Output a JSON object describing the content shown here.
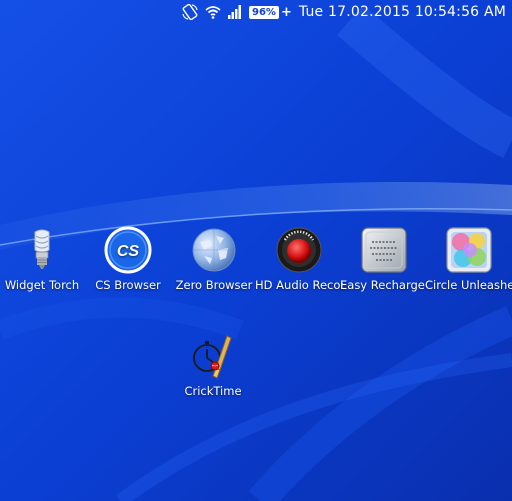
{
  "statusbar": {
    "battery_percent": "96%",
    "datetime": "Tue 17.02.2015 10:54:56 AM",
    "icons": [
      "rotate-icon",
      "wifi-icon",
      "signal-icon",
      "battery-icon"
    ]
  },
  "apps": [
    {
      "label": "Widget Torch",
      "icon": "bulb-icon"
    },
    {
      "label": "CS Browser",
      "icon": "cs-browser-icon",
      "badge": "CS"
    },
    {
      "label": "Zero Browser",
      "icon": "globe-icon"
    },
    {
      "label": "HD Audio Record",
      "icon": "record-icon"
    },
    {
      "label": "Easy Recharge BD",
      "icon": "recharge-icon"
    },
    {
      "label": "Circle Unleashed",
      "icon": "circle-unleashed-icon"
    },
    {
      "label": "CrickTime",
      "icon": "cricket-icon"
    }
  ]
}
